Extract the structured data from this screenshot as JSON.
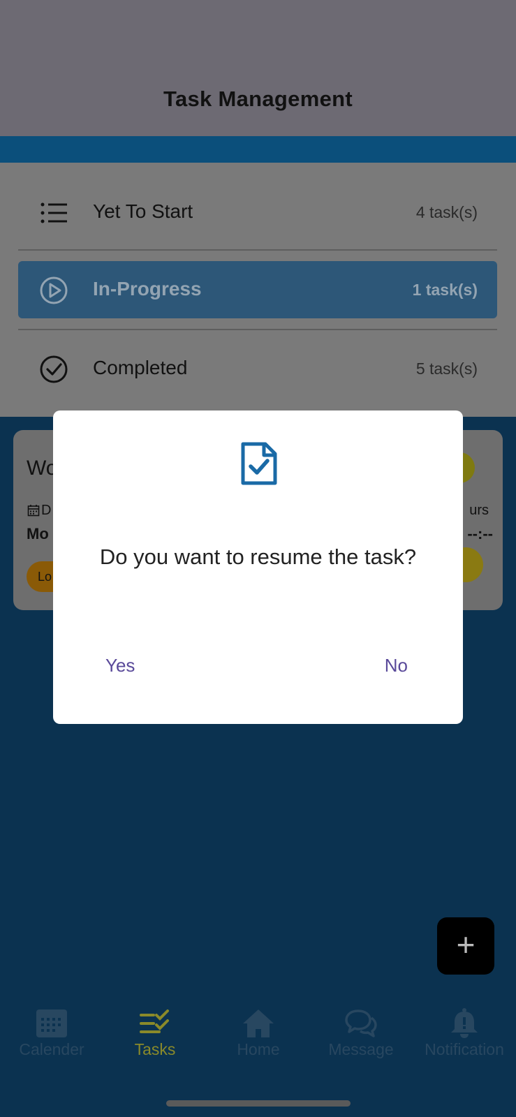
{
  "header": {
    "title": "Task Management"
  },
  "status_list": [
    {
      "label": "Yet To Start",
      "count": "4 task(s)",
      "icon": "list-icon",
      "active": false
    },
    {
      "label": "In-Progress",
      "count": "1 task(s)",
      "icon": "play-circle-icon",
      "active": true
    },
    {
      "label": "Completed",
      "count": "5 task(s)",
      "icon": "check-circle-icon",
      "active": false
    }
  ],
  "task_card": {
    "title_fragment": "Wo",
    "date_label_fragment": "D",
    "date_value_fragment": "Mo",
    "tag_fragment": "Lo",
    "hours_label_fragment": "urs",
    "time_value": "--:--"
  },
  "fab": {
    "icon": "plus-icon",
    "label": "+"
  },
  "bottom_nav": [
    {
      "label": "Calender",
      "icon": "calendar-icon"
    },
    {
      "label": "Tasks",
      "icon": "tasks-icon",
      "active": true
    },
    {
      "label": "Home",
      "icon": "home-icon"
    },
    {
      "label": "Message",
      "icon": "chat-icon"
    },
    {
      "label": "Notification",
      "icon": "bell-icon"
    }
  ],
  "modal": {
    "icon": "document-check-icon",
    "message": "Do you want to resume the task?",
    "yes_label": "Yes",
    "no_label": "No"
  },
  "colors": {
    "accent_blue": "#1a6aa6",
    "dialog_button": "#5a4a9a",
    "active_tab": "#8a8a2a"
  }
}
